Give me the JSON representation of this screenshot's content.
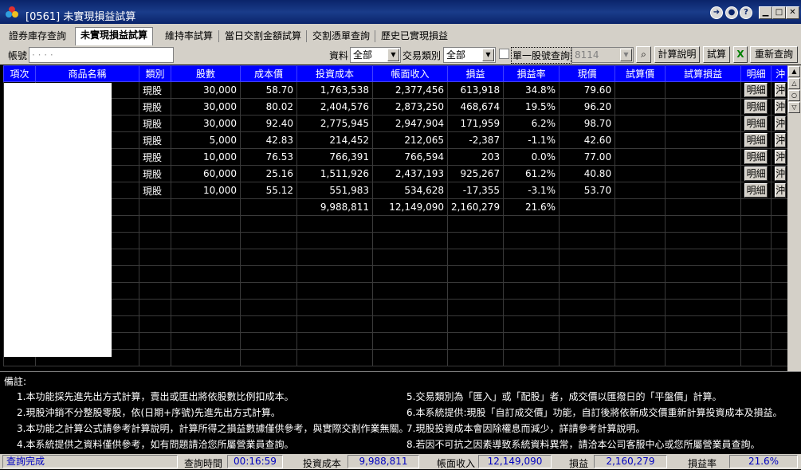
{
  "window": {
    "title": "[0561] 未實現損益試算"
  },
  "tabs": [
    "證券庫存查詢",
    "未實現損益試算",
    "維持率試算",
    "當日交割金額試算",
    "交割憑單查詢",
    "歷史已實現損益"
  ],
  "toolbar": {
    "account_label": "帳號",
    "account_value": "· · · ·",
    "data_label": "資料",
    "data_value": "全部",
    "trade_type_label": "交易類別",
    "trade_type_value": "全部",
    "single_stock_label": "單一股號查詢",
    "stock_code_value": "8114",
    "calc_desc_button": "計算說明",
    "trial_button": "試算",
    "refresh_button": "重新查詢"
  },
  "grid": {
    "headers": [
      "項次",
      "商品名稱",
      "類別",
      "股數",
      "成本價",
      "投資成本",
      "帳面收入",
      "損益",
      "損益率",
      "現價",
      "試算價",
      "試算損益",
      "明細",
      "沖"
    ],
    "rows": [
      {
        "type": "現股",
        "shares": "30,000",
        "cost_price": "58.70",
        "invest_cost": "1,763,538",
        "book_income": "2,377,456",
        "pnl": "613,918",
        "pnl_rate": "34.8%",
        "price": "79.60",
        "tone": "red"
      },
      {
        "type": "現股",
        "shares": "30,000",
        "cost_price": "80.02",
        "invest_cost": "2,404,576",
        "book_income": "2,873,250",
        "pnl": "468,674",
        "pnl_rate": "19.5%",
        "price": "96.20",
        "tone": "red"
      },
      {
        "type": "現股",
        "shares": "30,000",
        "cost_price": "92.40",
        "invest_cost": "2,775,945",
        "book_income": "2,947,904",
        "pnl": "171,959",
        "pnl_rate": "6.2%",
        "price": "98.70",
        "tone": "red"
      },
      {
        "type": "現股",
        "shares": "5,000",
        "cost_price": "42.83",
        "invest_cost": "214,452",
        "book_income": "212,065",
        "pnl": "-2,387",
        "pnl_rate": "-1.1%",
        "price": "42.60",
        "tone": "green"
      },
      {
        "type": "現股",
        "shares": "10,000",
        "cost_price": "76.53",
        "invest_cost": "766,391",
        "book_income": "766,594",
        "pnl": "203",
        "pnl_rate": "0.0%",
        "price": "77.00",
        "tone": "red-white"
      },
      {
        "type": "現股",
        "shares": "60,000",
        "cost_price": "25.16",
        "invest_cost": "1,511,926",
        "book_income": "2,437,193",
        "pnl": "925,267",
        "pnl_rate": "61.2%",
        "price": "40.80",
        "tone": "red"
      },
      {
        "type": "現股",
        "shares": "10,000",
        "cost_price": "55.12",
        "invest_cost": "551,983",
        "book_income": "534,628",
        "pnl": "-17,355",
        "pnl_rate": "-3.1%",
        "price": "53.70",
        "tone": "green"
      }
    ],
    "detail_label": "明細",
    "offset_label": "沖",
    "total": {
      "invest_cost": "9,988,811",
      "book_income": "12,149,090",
      "pnl": "2,160,279",
      "pnl_rate": "21.6%"
    }
  },
  "notes": {
    "title": "備註:",
    "left": [
      "1.本功能採先進先出方式計算，賣出或匯出將依股數比例扣成本。",
      "2.現股沖銷不分整股零股，依(日期+序號)先進先出方式計算。",
      "3.本功能之計算公式請參考計算說明，計算所得之損益數據僅供參考，與實際交割作業無關。",
      "4.本系統提供之資料僅供參考，如有問題請洽您所屬營業員查詢。"
    ],
    "right": [
      "5.交易類別為「匯入」或「配股」者，成交價以匯撥日的「平盤價」計算。",
      "6.本系統提供:現股「自訂成交價」功能，自訂後將依新成交價重新計算投資成本及損益。",
      "7.現股投資成本會因除權息而減少，詳請參考計算說明。",
      "8.若因不可抗之因素導致系統資料異常，請洽本公司客服中心或您所屬營業員查詢。"
    ]
  },
  "status": {
    "message": "查詢完成",
    "query_time_label": "查詢時間",
    "query_time": "00:16:59",
    "invest_cost_label": "投資成本",
    "invest_cost": "9,988,811",
    "book_income_label": "帳面收入",
    "book_income": "12,149,090",
    "pnl_label": "損益",
    "pnl": "2,160,279",
    "pnl_rate_label": "損益率",
    "pnl_rate": "21.6%"
  },
  "colors": {
    "header_bg": "#0000ff",
    "profit": "#ff2020",
    "loss": "#20ff20",
    "panel_bg": "#000000",
    "chrome": "#d4d0c8"
  }
}
